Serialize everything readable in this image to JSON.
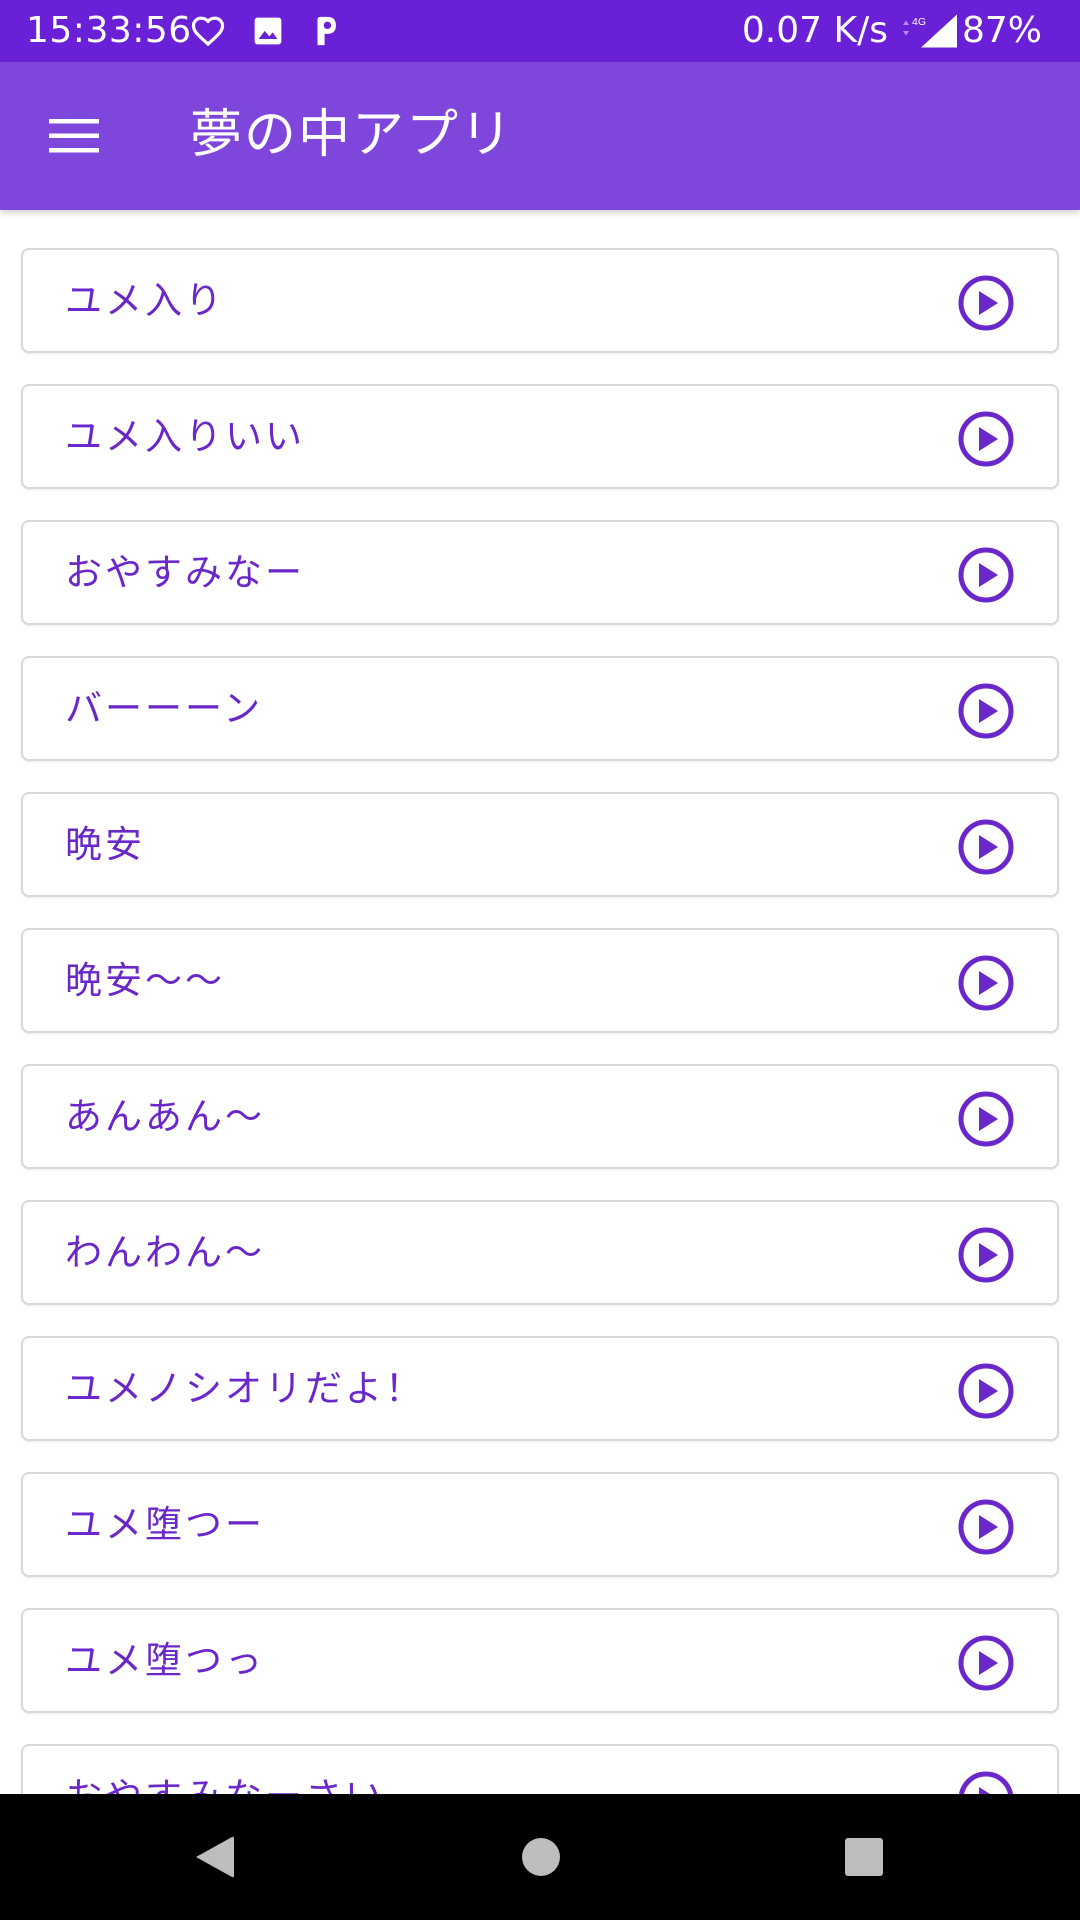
{
  "status_bar": {
    "time": "15:33:56",
    "speed": "0.07 K/s",
    "network": "4G",
    "battery": "87%",
    "icons": [
      "heart-icon",
      "image-icon",
      "p-app-icon",
      "data-arrows-icon",
      "signal-icon"
    ]
  },
  "app_bar": {
    "title": "夢の中アプリ",
    "menu_icon": "hamburger-menu-icon"
  },
  "colors": {
    "status_bar": "#6a20d6",
    "app_bar": "#7f46dc",
    "accent_text": "#6a27c9",
    "card_border": "#d8d8d8"
  },
  "sounds": [
    {
      "label": "ユメ入り"
    },
    {
      "label": "ユメ入りいい"
    },
    {
      "label": "おやすみなー"
    },
    {
      "label": "バーーーン"
    },
    {
      "label": "晩安"
    },
    {
      "label": "晩安～～"
    },
    {
      "label": "あんあん～"
    },
    {
      "label": "わんわん～"
    },
    {
      "label": "ユメノシオリだよ！"
    },
    {
      "label": "ユメ堕つー"
    },
    {
      "label": "ユメ堕つっ"
    },
    {
      "label": "おやすみなーさい"
    }
  ],
  "nav_bar": {
    "back": "back-triangle-icon",
    "home": "home-circle-icon",
    "recents": "recents-square-icon"
  }
}
